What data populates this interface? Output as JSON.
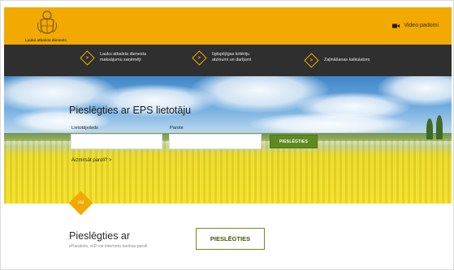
{
  "header": {
    "logo_text": "Lauku atbalsta dienests",
    "video_link": "Video padomi",
    "video_icon": "video-camera-icon",
    "accent": "#f2a900"
  },
  "nav": {
    "items": [
      {
        "line1": "Lauku atbalsta dienesta",
        "line2": "maksājumu saņēmēji",
        "icon": "chevron-diamond-icon"
      },
      {
        "line1": "Ilgtspējīgas kritēriju",
        "line2": "atzinumi un darījumi",
        "icon": "chevron-diamond-icon"
      },
      {
        "line1": "Zaļināšanas kalkulators",
        "line2": "",
        "icon": "chevron-diamond-icon"
      }
    ]
  },
  "hero": {
    "title": "Pieslēgties ar EPS lietotāju",
    "username_label": "Lietotājvārds",
    "password_label": "Parole",
    "username_value": "",
    "password_value": "",
    "login_button": "PIESLĒGTIES",
    "forgot_link": "Aizmirsāt paroli? >"
  },
  "lower": {
    "divider_text": "vai",
    "title": "Pieslēgties ar",
    "subtitle": "eParakstu, eID vai interneta bankas paroli",
    "login_button": "PIESLĒGTIES"
  }
}
